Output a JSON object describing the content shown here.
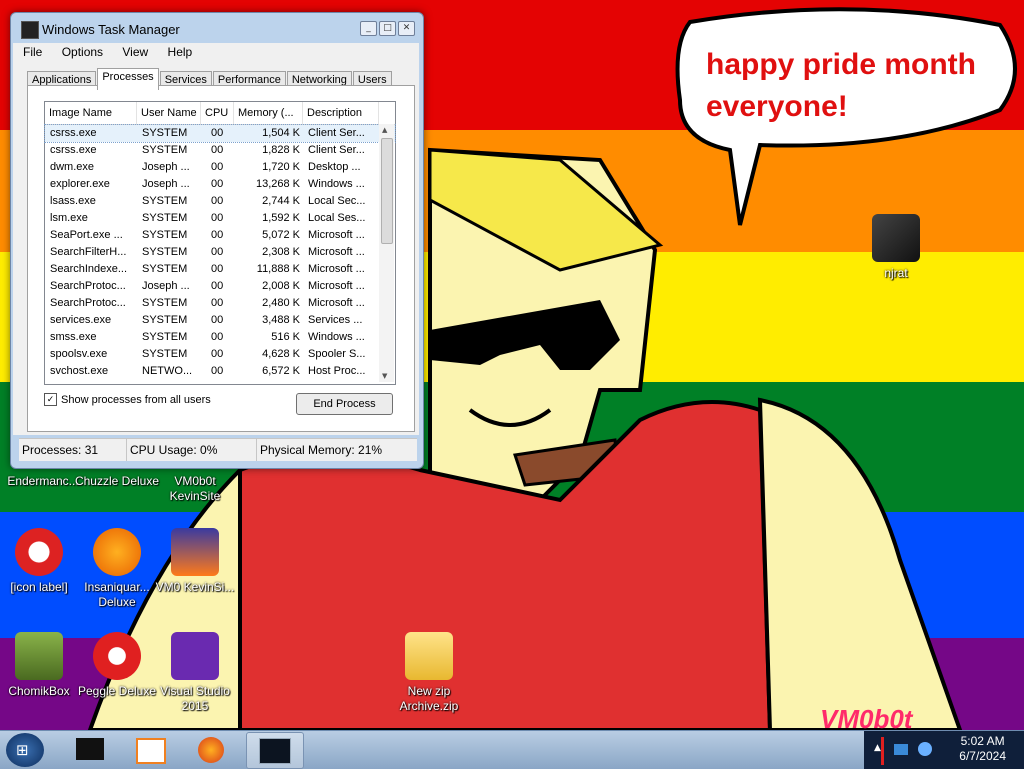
{
  "desktop": {
    "speech_bubble": [
      "happy pride month",
      "everyone!"
    ],
    "watermark": "VM0b0t",
    "icons": [
      {
        "id": "njrat",
        "label": "njrat"
      },
      {
        "id": "endermanch",
        "label": "Endermanc..."
      },
      {
        "id": "chuzzle",
        "label": "Chuzzle Deluxe"
      },
      {
        "id": "vm0b0t-kevinsite",
        "label": "VM0b0t KevinSite"
      },
      {
        "id": "none-of-you",
        "label": "[icon label]"
      },
      {
        "id": "insaniquarium",
        "label": "Insaniquar... Deluxe"
      },
      {
        "id": "vm0-kevinsi",
        "label": "VM0 KevinSi..."
      },
      {
        "id": "chomikbox",
        "label": "ChomikBox"
      },
      {
        "id": "peggle",
        "label": "Peggle Deluxe"
      },
      {
        "id": "visual-studio",
        "label": "Visual Studio 2015"
      },
      {
        "id": "new-zip",
        "label": "New zip Archive.zip"
      }
    ]
  },
  "window": {
    "title": "Windows Task Manager",
    "controls": [
      "_",
      "□",
      "✕"
    ],
    "menu": [
      "File",
      "Options",
      "View",
      "Help"
    ],
    "tabs": [
      "Applications",
      "Processes",
      "Services",
      "Performance",
      "Networking",
      "Users"
    ],
    "active_tab": "Processes",
    "columns": [
      "Image Name",
      "User Name",
      "CPU",
      "Memory (...",
      "Description"
    ],
    "rows": [
      [
        "csrss.exe",
        "SYSTEM",
        "00",
        "1,504 K",
        "Client Ser..."
      ],
      [
        "csrss.exe",
        "SYSTEM",
        "00",
        "1,828 K",
        "Client Ser..."
      ],
      [
        "dwm.exe",
        "Joseph ...",
        "00",
        "1,720 K",
        "Desktop ..."
      ],
      [
        "explorer.exe",
        "Joseph ...",
        "00",
        "13,268 K",
        "Windows ..."
      ],
      [
        "lsass.exe",
        "SYSTEM",
        "00",
        "2,744 K",
        "Local Sec..."
      ],
      [
        "lsm.exe",
        "SYSTEM",
        "00",
        "1,592 K",
        "Local Ses..."
      ],
      [
        "SeaPort.exe ...",
        "SYSTEM",
        "00",
        "5,072 K",
        "Microsoft ..."
      ],
      [
        "SearchFilterH...",
        "SYSTEM",
        "00",
        "2,308 K",
        "Microsoft ..."
      ],
      [
        "SearchIndexe...",
        "SYSTEM",
        "00",
        "11,888 K",
        "Microsoft ..."
      ],
      [
        "SearchProtoc...",
        "Joseph ...",
        "00",
        "2,008 K",
        "Microsoft ..."
      ],
      [
        "SearchProtoc...",
        "SYSTEM",
        "00",
        "2,480 K",
        "Microsoft ..."
      ],
      [
        "services.exe",
        "SYSTEM",
        "00",
        "3,488 K",
        "Services ..."
      ],
      [
        "smss.exe",
        "SYSTEM",
        "00",
        "516 K",
        "Windows ..."
      ],
      [
        "spoolsv.exe",
        "SYSTEM",
        "00",
        "4,628 K",
        "Spooler S..."
      ],
      [
        "svchost.exe",
        "NETWO...",
        "00",
        "6,572 K",
        "Host Proc..."
      ]
    ],
    "show_all_label": "Show processes from all users",
    "show_all_checked": true,
    "end_process_label": "End Process",
    "status": {
      "processes": "Processes: 31",
      "cpu": "CPU Usage: 0%",
      "memory": "Physical Memory: 21%"
    }
  },
  "taskbar": {
    "start_label": "⊞",
    "time": "5:02 AM",
    "date": "6/7/2024"
  }
}
